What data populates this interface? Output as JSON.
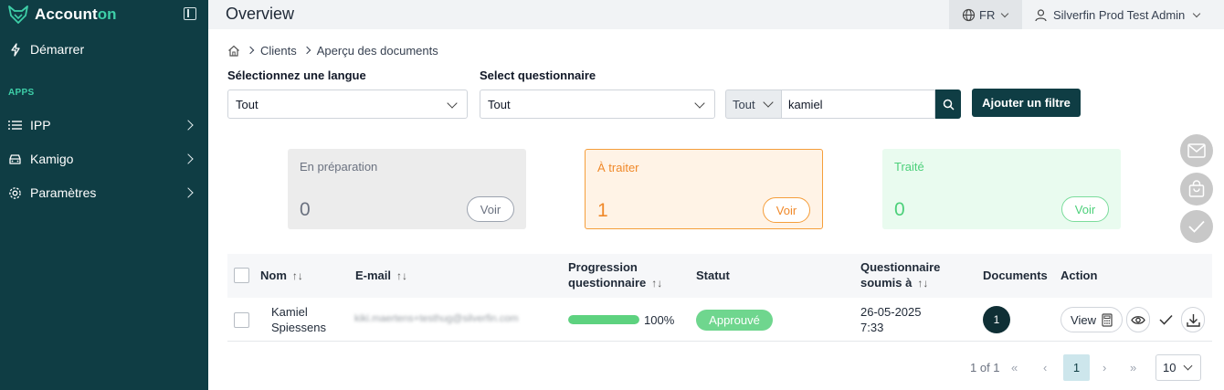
{
  "app": {
    "logo_text_main": "Account",
    "logo_text_accent": "on",
    "brand_color": "#0f3d44",
    "accent_color": "#3ecfa8"
  },
  "sidebar": {
    "start_label": "Démarrer",
    "apps_label": "APPS",
    "items": [
      {
        "label": "IPP",
        "icon": "list-icon"
      },
      {
        "label": "Kamigo",
        "icon": "car-icon"
      },
      {
        "label": "Paramètres",
        "icon": "gear-icon"
      }
    ]
  },
  "topbar": {
    "title": "Overview",
    "language": "FR",
    "user": "Silverfin Prod Test Admin"
  },
  "breadcrumb": [
    "Clients",
    "Aperçu des documents"
  ],
  "filters": {
    "language_label": "Sélectionnez une langue",
    "language_value": "Tout",
    "questionnaire_label": "Select questionnaire",
    "questionnaire_value": "Tout",
    "search_scope": "Tout",
    "search_value": "kamiel",
    "add_filter_label": "Ajouter un filtre"
  },
  "cards": {
    "prep": {
      "title": "En préparation",
      "count": "0",
      "button": "Voir",
      "color": "#6b7280"
    },
    "todo": {
      "title": "À traiter",
      "count": "1",
      "button": "Voir",
      "color": "#f0892a"
    },
    "done": {
      "title": "Traité",
      "count": "0",
      "button": "Voir",
      "color": "#4cd07a"
    }
  },
  "table": {
    "headers": {
      "name": "Nom",
      "email": "E-mail",
      "progress_l1": "Progression",
      "progress_l2": "questionnaire",
      "status": "Statut",
      "submitted_l1": "Questionnaire",
      "submitted_l2": "soumis à",
      "documents": "Documents",
      "action": "Action"
    },
    "rows": [
      {
        "name_l1": "Kamiel",
        "name_l2": "Spiessens",
        "email": "kiki.maertens+testhug@silverfin.com",
        "progress": 100,
        "progress_label": "100%",
        "status": "Approuvé",
        "date": "26-05-2025",
        "time": "7:33",
        "documents": "1",
        "view_label": "View"
      }
    ]
  },
  "pagination": {
    "info": "1 of 1",
    "current": "1",
    "page_size": "10"
  }
}
